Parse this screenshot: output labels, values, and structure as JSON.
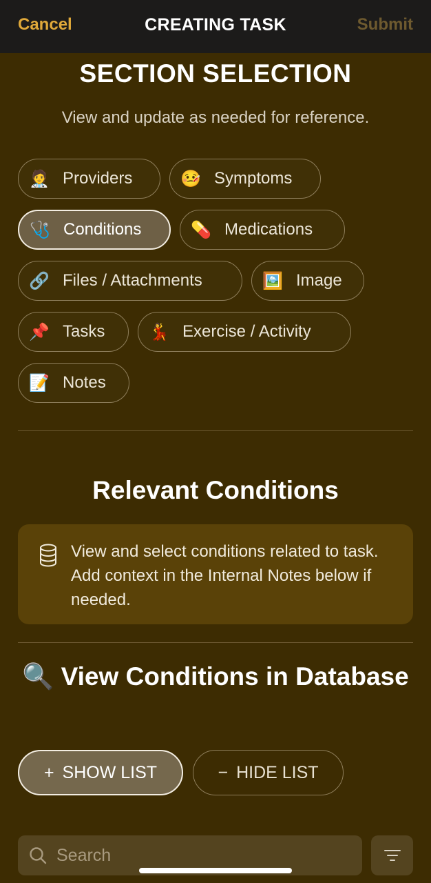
{
  "topbar": {
    "cancel": "Cancel",
    "title": "CREATING TASK",
    "submit": "Submit"
  },
  "section": {
    "title": "SECTION SELECTION",
    "subtitle": "View and update as needed for reference.",
    "chips": [
      {
        "label": "Providers",
        "icon": "🧑‍⚕️",
        "active": false
      },
      {
        "label": "Symptoms",
        "icon": "🤒",
        "active": false
      },
      {
        "label": "Conditions",
        "icon": "🩺",
        "active": true
      },
      {
        "label": "Medications",
        "icon": "💊",
        "active": false
      },
      {
        "label": "Files / Attachments",
        "icon": "🔗",
        "active": false
      },
      {
        "label": "Image",
        "icon": "🖼️",
        "active": false
      },
      {
        "label": "Tasks",
        "icon": "📌",
        "active": false
      },
      {
        "label": "Exercise / Activity",
        "icon": "💃",
        "active": false
      },
      {
        "label": "Notes",
        "icon": "📝",
        "active": false
      }
    ]
  },
  "relevant": {
    "title": "Relevant Conditions",
    "info": "View and select conditions related to task. Add context in the Internal Notes below if needed.",
    "info_icon": "database-icon"
  },
  "database": {
    "icon": "🔍",
    "title": "View Conditions in Database",
    "show_list": "SHOW LIST",
    "hide_list": "HIDE LIST",
    "show_symbol": "+",
    "hide_symbol": "−"
  },
  "search": {
    "placeholder": "Search",
    "value": ""
  },
  "colors": {
    "accent": "#e0a93a",
    "background": "#3d2c02",
    "info_box": "#5a4208"
  }
}
